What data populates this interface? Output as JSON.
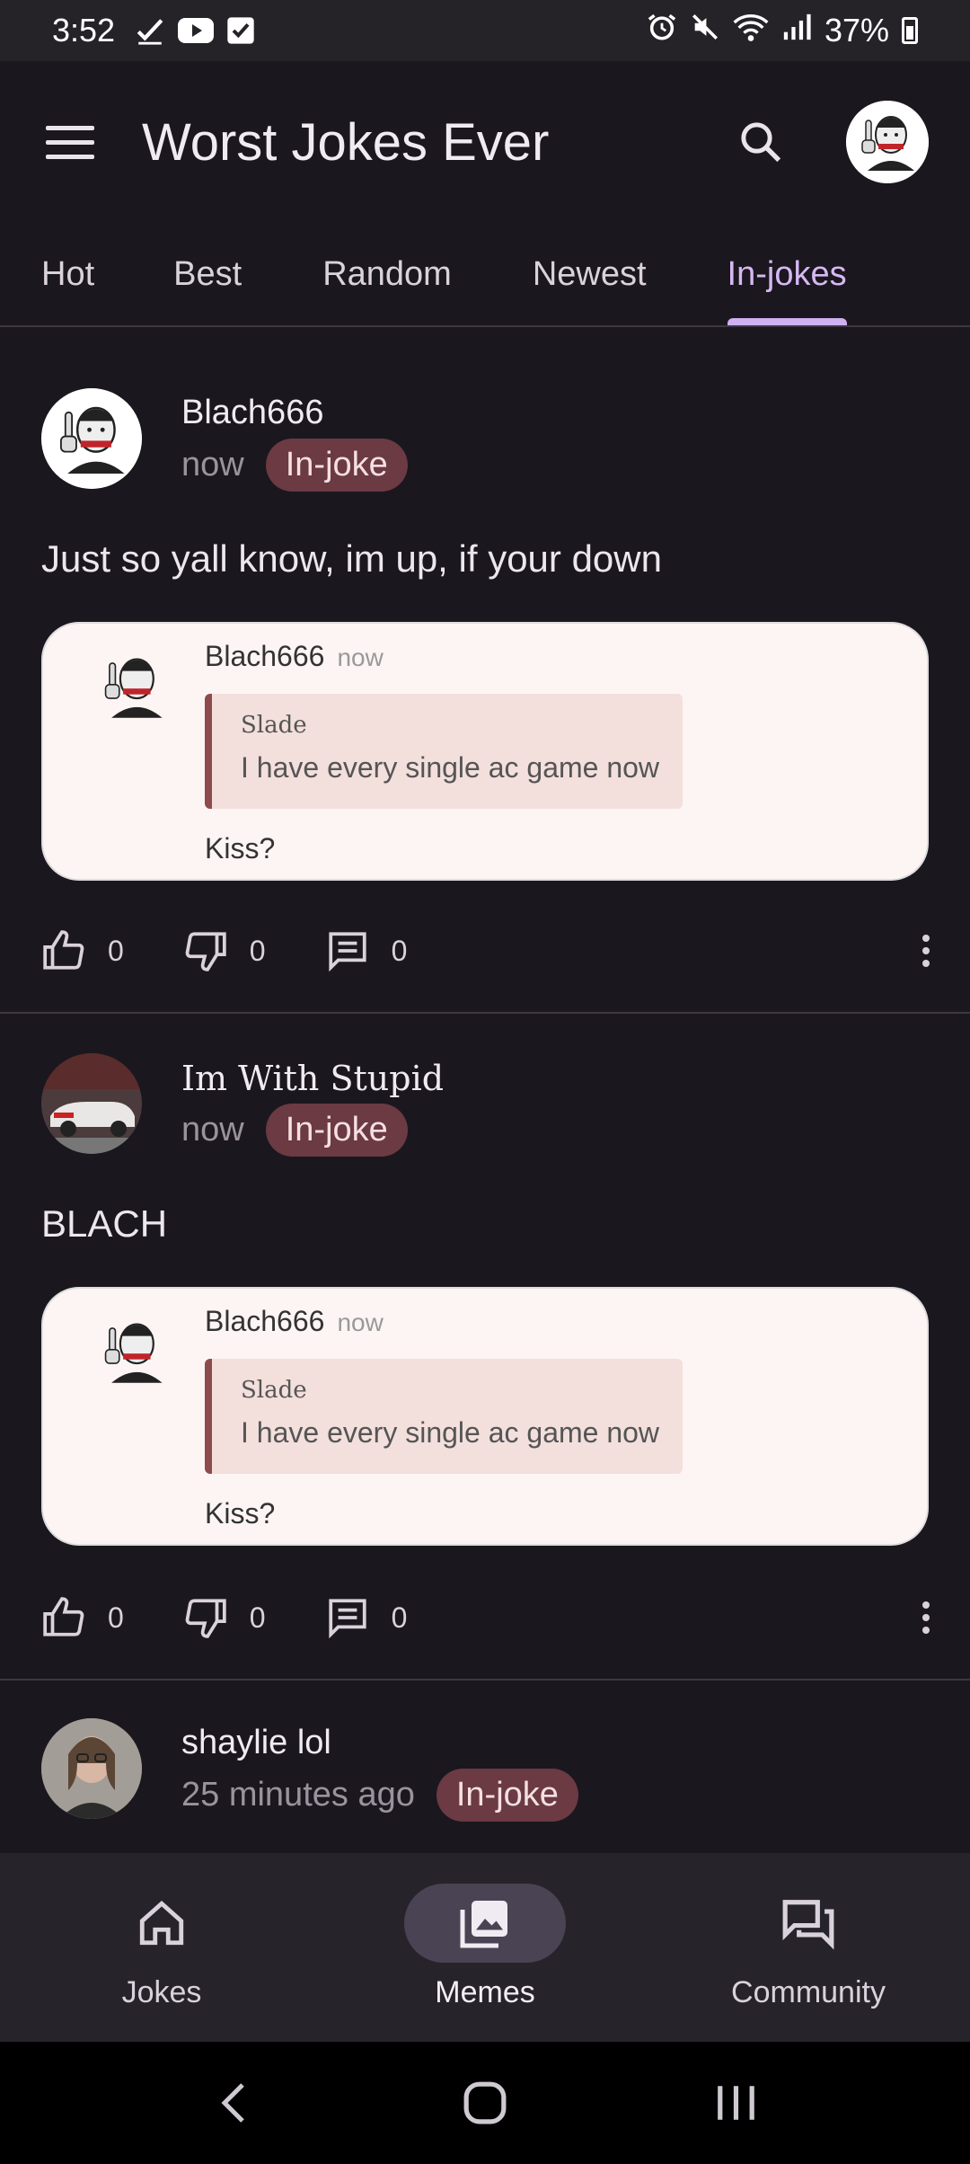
{
  "status_bar": {
    "time": "3:52",
    "battery": "37%"
  },
  "app": {
    "title": "Worst Jokes Ever"
  },
  "tabs": [
    {
      "label": "Hot"
    },
    {
      "label": "Best"
    },
    {
      "label": "Random"
    },
    {
      "label": "Newest"
    },
    {
      "label": "In-jokes",
      "active": true
    }
  ],
  "posts": [
    {
      "author": "Blach666",
      "time": "now",
      "badge": "In-joke",
      "text": "Just so yall know, im up, if your down",
      "embed": {
        "author": "Blach666",
        "time": "now",
        "quote_author": "Slade",
        "quote_text": "I have every single ac game now",
        "message": "Kiss?"
      },
      "likes": "0",
      "dislikes": "0",
      "comments": "0"
    },
    {
      "author": "Im With Stupid",
      "time": "now",
      "badge": "In-joke",
      "text": "BLACH",
      "embed": {
        "author": "Blach666",
        "time": "now",
        "quote_author": "Slade",
        "quote_text": "I have every single ac game now",
        "message": "Kiss?"
      },
      "likes": "0",
      "dislikes": "0",
      "comments": "0"
    },
    {
      "author": "shaylie lol",
      "time": "25 minutes ago",
      "badge": "In-joke"
    }
  ],
  "bottom_nav": [
    {
      "label": "Jokes",
      "icon": "home-icon"
    },
    {
      "label": "Memes",
      "icon": "image-icon",
      "active": true
    },
    {
      "label": "Community",
      "icon": "forum-icon"
    }
  ],
  "colors": {
    "background": "#1b171e",
    "accent": "#cfb0f1",
    "badge": "#6b3a43"
  }
}
